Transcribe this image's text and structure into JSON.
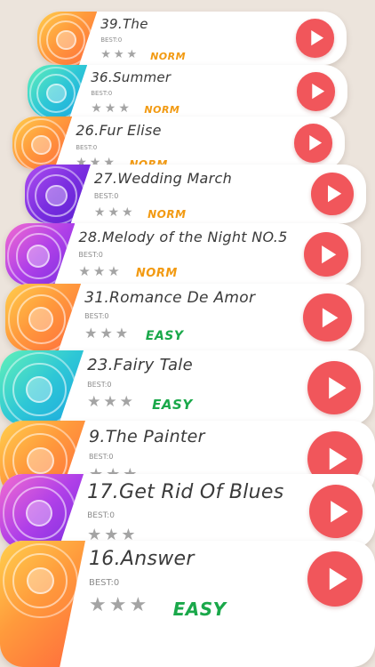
{
  "colors": {
    "background": "#ece4dc",
    "play_button": "#f1565b",
    "norm": "#f29a12",
    "easy": "#1aa84a",
    "best_text": "#8c8c8c",
    "star": "#a4a4a4"
  },
  "songs": [
    {
      "title": "39.The",
      "best": "BEST:0",
      "difficulty": "NORM",
      "stars_earned": 0,
      "stars_total": 3,
      "disc_theme": "orange",
      "icon": "disc-icon",
      "action_icon": "play-icon"
    },
    {
      "title": "36.Summer",
      "best": "BEST:0",
      "difficulty": "NORM",
      "stars_earned": 0,
      "stars_total": 3,
      "disc_theme": "teal",
      "icon": "disc-icon",
      "action_icon": "play-icon"
    },
    {
      "title": "26.Fur Elise",
      "best": "BEST:0",
      "difficulty": "NORM",
      "stars_earned": 0,
      "stars_total": 3,
      "disc_theme": "orange",
      "icon": "disc-icon",
      "action_icon": "play-icon"
    },
    {
      "title": "27.Wedding March",
      "best": "BEST:0",
      "difficulty": "NORM",
      "stars_earned": 0,
      "stars_total": 3,
      "disc_theme": "purple",
      "icon": "disc-icon",
      "action_icon": "play-icon"
    },
    {
      "title": "28.Melody of the Night NO.5",
      "best": "BEST:0",
      "difficulty": "NORM",
      "stars_earned": 0,
      "stars_total": 3,
      "disc_theme": "pink-purple",
      "icon": "disc-icon",
      "action_icon": "play-icon"
    },
    {
      "title": "31.Romance De Amor",
      "best": "BEST:0",
      "difficulty": "EASY",
      "stars_earned": 0,
      "stars_total": 3,
      "disc_theme": "orange",
      "icon": "disc-icon",
      "action_icon": "play-icon"
    },
    {
      "title": "23.Fairy Tale",
      "best": "BEST:0",
      "difficulty": "EASY",
      "stars_earned": 0,
      "stars_total": 3,
      "disc_theme": "teal",
      "icon": "disc-icon",
      "action_icon": "play-icon"
    },
    {
      "title": "9.The Painter",
      "best": "BEST:0",
      "difficulty": "",
      "stars_earned": 0,
      "stars_total": 3,
      "disc_theme": "orange",
      "icon": "disc-icon",
      "action_icon": "play-icon"
    },
    {
      "title": "17.Get Rid Of Blues",
      "best": "BEST:0",
      "difficulty": "",
      "stars_earned": 0,
      "stars_total": 3,
      "disc_theme": "pink-purple",
      "icon": "disc-icon",
      "action_icon": "play-icon"
    },
    {
      "title": "16.Answer",
      "best": "BEST:0",
      "difficulty": "EASY",
      "stars_earned": 0,
      "stars_total": 3,
      "disc_theme": "orange",
      "icon": "disc-icon",
      "action_icon": "play-icon"
    }
  ]
}
